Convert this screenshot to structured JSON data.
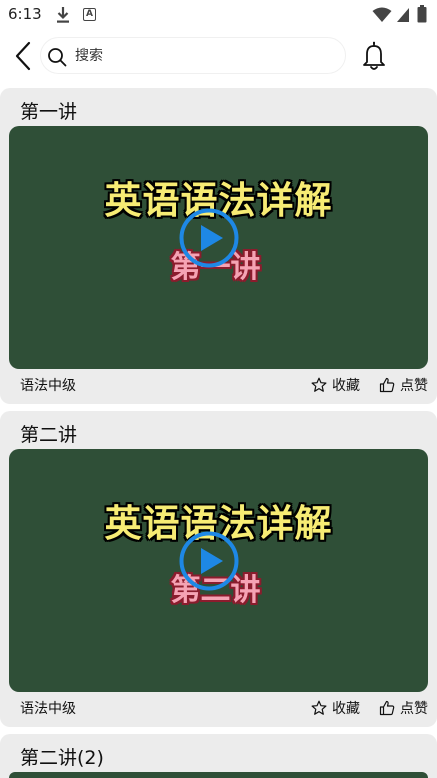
{
  "status_bar": {
    "time": "6:13",
    "badge_letter": "A",
    "icons": [
      "download-icon",
      "a-badge-icon",
      "wifi-icon",
      "signal-icon",
      "battery-icon"
    ]
  },
  "header": {
    "search_placeholder": "搜索",
    "icons": [
      "back-arrow-icon",
      "search-icon",
      "bell-icon"
    ]
  },
  "colors": {
    "card_background": "#ececec",
    "video_board": "#2f4f37",
    "video_title": "#f7ec74",
    "video_subtitle": "#f5a3b4",
    "play_accent": "#1e88e5"
  },
  "videos": [
    {
      "title": "第一讲",
      "thumb_heading": "英语语法详解",
      "thumb_sub": "第一讲",
      "level": "语法中级",
      "favorite_label": "收藏",
      "like_label": "点赞"
    },
    {
      "title": "第二讲",
      "thumb_heading": "英语语法详解",
      "thumb_sub": "第二讲",
      "level": "语法中级",
      "favorite_label": "收藏",
      "like_label": "点赞"
    },
    {
      "title": "第二讲(2)"
    }
  ]
}
